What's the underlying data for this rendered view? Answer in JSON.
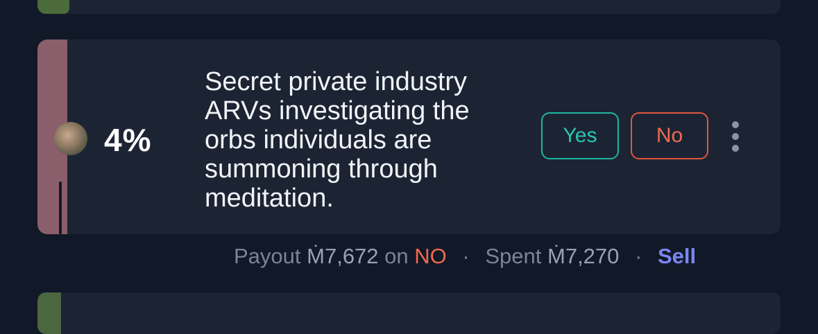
{
  "market": {
    "probability": "4%",
    "question": "Secret private industry ARVs investigating the orbs individuals are summoning through meditation.",
    "buttons": {
      "yes": "Yes",
      "no": "No"
    }
  },
  "position": {
    "payout_label": "Payout",
    "payout_amount": "Ṁ7,672",
    "on_label": "on",
    "side": "NO",
    "separator": "·",
    "spent_label": "Spent",
    "spent_amount": "Ṁ7,270",
    "sell_label": "Sell"
  },
  "colors": {
    "background": "#111827",
    "card": "#1c2434",
    "yes": "#2ac4ae",
    "no": "#f06a4f",
    "sell": "#7b86ef",
    "stripe": "#8a5e6a"
  }
}
